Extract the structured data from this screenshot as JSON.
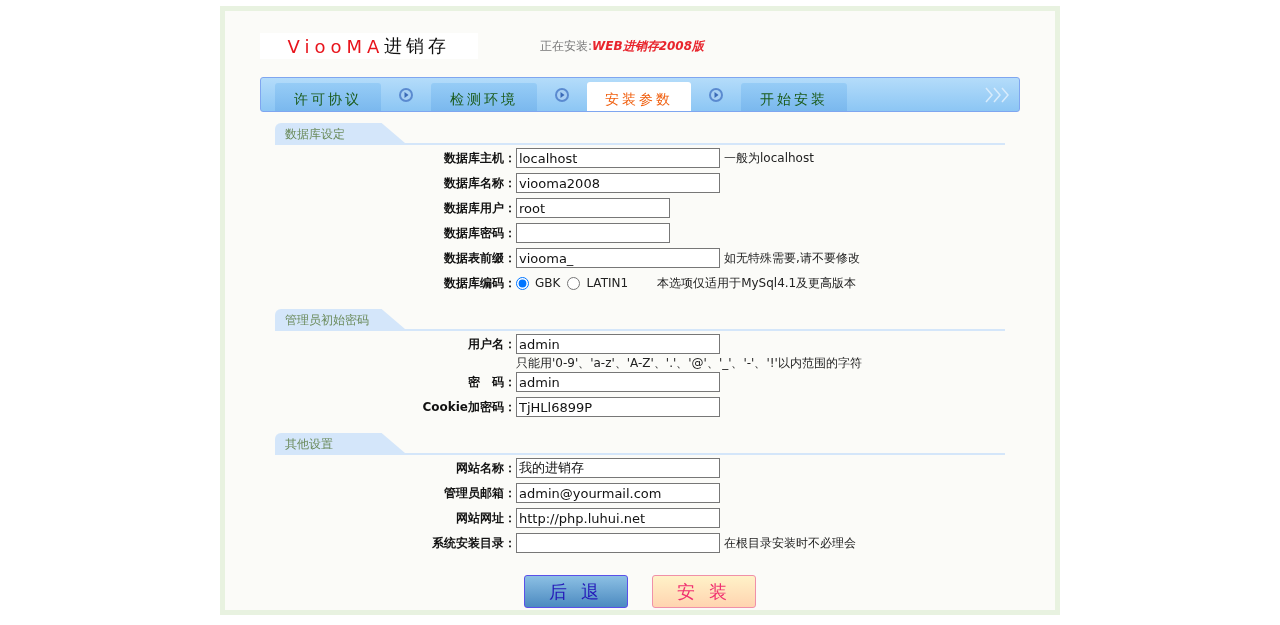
{
  "header": {
    "brand_latin": "ViooMA",
    "brand_cn": "进销存",
    "installing_label": "正在安装:",
    "installing_product": "WEB进销存2008版"
  },
  "tabs": [
    {
      "label": "许可协议",
      "selected": false
    },
    {
      "label": "检测环境",
      "selected": false
    },
    {
      "label": "安装参数",
      "selected": true
    },
    {
      "label": "开始安装",
      "selected": false
    }
  ],
  "sections": [
    {
      "title": "数据库设定",
      "fields": [
        {
          "kind": "text",
          "label": "数据库主机：",
          "value": "localhost",
          "note": "一般为localhost"
        },
        {
          "kind": "text",
          "label": "数据库名称：",
          "value": "viooma2008"
        },
        {
          "kind": "short",
          "label": "数据库用户：",
          "value": "root"
        },
        {
          "kind": "short",
          "label": "数据库密码："
        },
        {
          "kind": "text",
          "label": "数据表前缀：",
          "value": "viooma_",
          "note": "如无特殊需要,请不要修改"
        },
        {
          "kind": "radio",
          "label": "数据库编码：",
          "options": [
            {
              "label": "GBK",
              "selected": true
            },
            {
              "label": "LATIN1",
              "selected": false
            }
          ],
          "note": "本选项仅适用于MySql4.1及更高版本"
        }
      ]
    },
    {
      "title": "管理员初始密码",
      "fields": [
        {
          "kind": "text",
          "label": "用户名：",
          "value": "admin",
          "hint": "只能用'0-9'、'a-z'、'A-Z'、'.'、'@'、'_'、'-'、'!'以内范围的字符"
        },
        {
          "kind": "text",
          "label": "密　码：",
          "value": "admin"
        },
        {
          "kind": "text",
          "label": "Cookie加密码：",
          "value": "TjHLl6899P"
        }
      ]
    },
    {
      "title": "其他设置",
      "fields": [
        {
          "kind": "text",
          "label": "网站名称：",
          "value": "我的进销存"
        },
        {
          "kind": "text",
          "label": "管理员邮箱：",
          "value": "admin@yourmail.com"
        },
        {
          "kind": "text",
          "label": "网站网址：",
          "value": "http://php.luhui.net"
        },
        {
          "kind": "text",
          "label": "系统安装目录：",
          "note": "在根目录安装时不必理会"
        }
      ]
    }
  ],
  "buttons": [
    {
      "kind": "back",
      "label": "后 退"
    },
    {
      "kind": "install",
      "label": "安 装"
    }
  ]
}
